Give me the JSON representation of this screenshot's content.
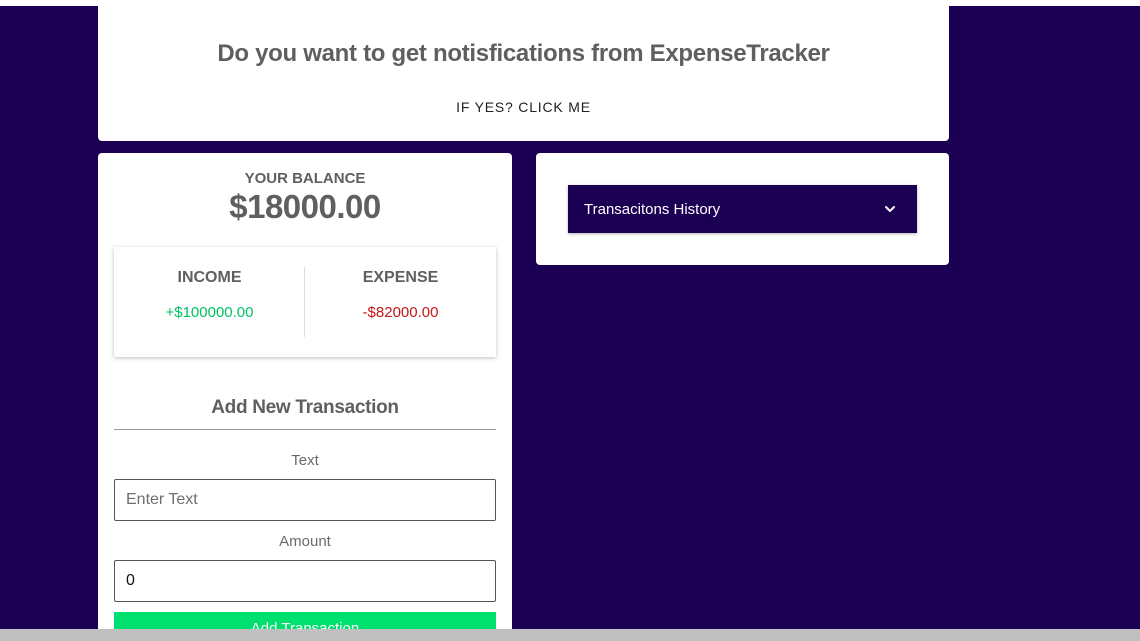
{
  "notification": {
    "title": "Do you want to get notisfications from ExpenseTracker",
    "link": "IF YES? CLICK ME"
  },
  "balance": {
    "label": "YOUR BALANCE",
    "value": "$18000.00"
  },
  "summary": {
    "income_label": "INCOME",
    "income_value": "+$100000.00",
    "expense_label": "EXPENSE",
    "expense_value": "-$82000.00"
  },
  "form": {
    "title": "Add New Transaction",
    "text_label": "Text",
    "text_placeholder": "Enter Text",
    "amount_label": "Amount",
    "amount_value": "0",
    "submit_label": "Add Transaction"
  },
  "history": {
    "label": "Transacitons History",
    "icon": "chevron-down-icon"
  },
  "colors": {
    "background": "#1c0054",
    "income": "#00c264",
    "expense": "#c01717",
    "button": "#00e06e"
  }
}
